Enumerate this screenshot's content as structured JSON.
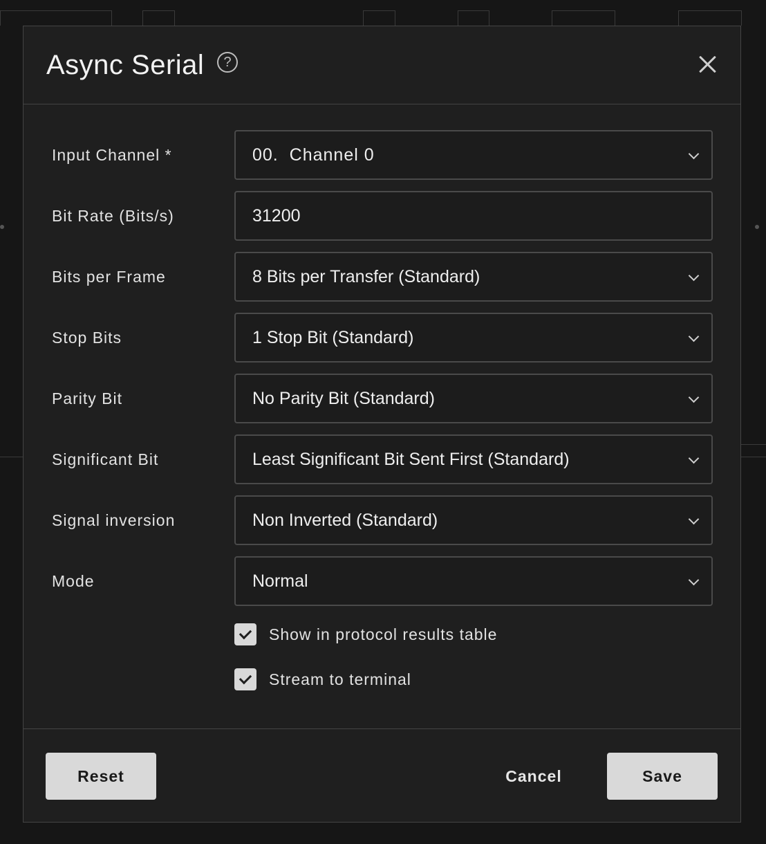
{
  "dialog": {
    "title": "Async Serial",
    "help_icon": "help-circle-icon",
    "close_icon": "close-icon"
  },
  "fields": [
    {
      "label": "Input Channel *",
      "value": "00.  Channel 0",
      "type": "select"
    },
    {
      "label": "Bit Rate (Bits/s)",
      "value": "31200",
      "type": "input"
    },
    {
      "label": "Bits per Frame",
      "value": "8 Bits per Transfer (Standard)",
      "type": "select"
    },
    {
      "label": "Stop Bits",
      "value": "1 Stop Bit (Standard)",
      "type": "select"
    },
    {
      "label": "Parity Bit",
      "value": "No Parity Bit (Standard)",
      "type": "select"
    },
    {
      "label": "Significant Bit",
      "value": "Least Significant Bit Sent First (Standard)",
      "type": "select"
    },
    {
      "label": "Signal inversion",
      "value": "Non Inverted (Standard)",
      "type": "select"
    },
    {
      "label": "Mode",
      "value": "Normal",
      "type": "select"
    }
  ],
  "checkboxes": [
    {
      "label": "Show in protocol results table",
      "checked": true
    },
    {
      "label": "Stream to terminal",
      "checked": true
    }
  ],
  "footer": {
    "reset_label": "Reset",
    "cancel_label": "Cancel",
    "save_label": "Save"
  },
  "colors": {
    "background": "#161616",
    "dialog": "#1f1f1f",
    "border": "#444444",
    "button_light": "#d9d9d9"
  }
}
